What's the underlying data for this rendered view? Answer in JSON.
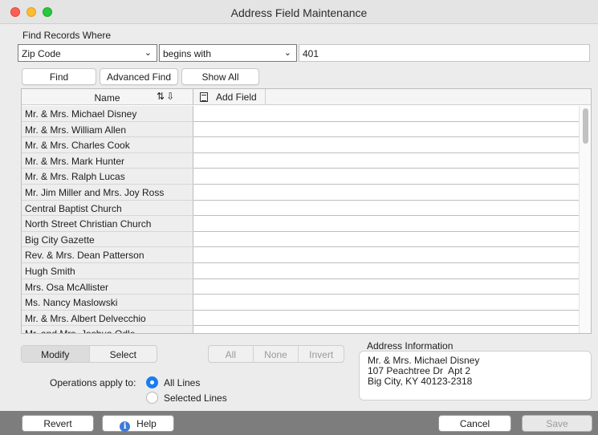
{
  "window": {
    "title": "Address Field Maintenance"
  },
  "find": {
    "section_label": "Find Records Where",
    "field_select": "Zip Code",
    "operator_select": "begins with",
    "search_value": "401",
    "find_label": "Find",
    "advanced_find_label": "Advanced Find",
    "show_all_label": "Show All"
  },
  "table": {
    "name_header": "Name",
    "add_field_label": "Add Field",
    "rows": [
      "Mr. & Mrs. Michael Disney",
      "Mr. & Mrs. William Allen",
      "Mr. & Mrs. Charles Cook",
      "Mr. & Mrs. Mark Hunter",
      "Mr. & Mrs. Ralph Lucas",
      "Mr. Jim Miller and Mrs. Joy Ross",
      "Central Baptist Church",
      "North Street Christian Church",
      "Big City Gazette",
      "Rev. & Mrs. Dean Patterson",
      "Hugh Smith",
      "Mrs. Osa McAllister",
      "Ms. Nancy Maslowski",
      "Mr. & Mrs. Albert Delvecchio",
      "Mr. and Mrs. Joshua Odle"
    ]
  },
  "mode": {
    "modify": "Modify",
    "select": "Select"
  },
  "selection": {
    "all": "All",
    "none": "None",
    "invert": "Invert"
  },
  "operations": {
    "label": "Operations apply to:",
    "all_lines": "All Lines",
    "selected_lines": "Selected Lines"
  },
  "address": {
    "label": "Address Information",
    "line1": "Mr. & Mrs. Michael Disney",
    "line2": "107 Peachtree Dr  Apt 2",
    "line3": "Big City, KY 40123-2318"
  },
  "footer": {
    "revert": "Revert",
    "help": "Help",
    "cancel": "Cancel",
    "save": "Save"
  },
  "colors": {
    "accent": "#1a7cf0",
    "bottom_bar": "#7d7d7d"
  },
  "icons": [
    "sort-az-icon",
    "sort-custom-icon",
    "document-icon",
    "info-icon"
  ]
}
